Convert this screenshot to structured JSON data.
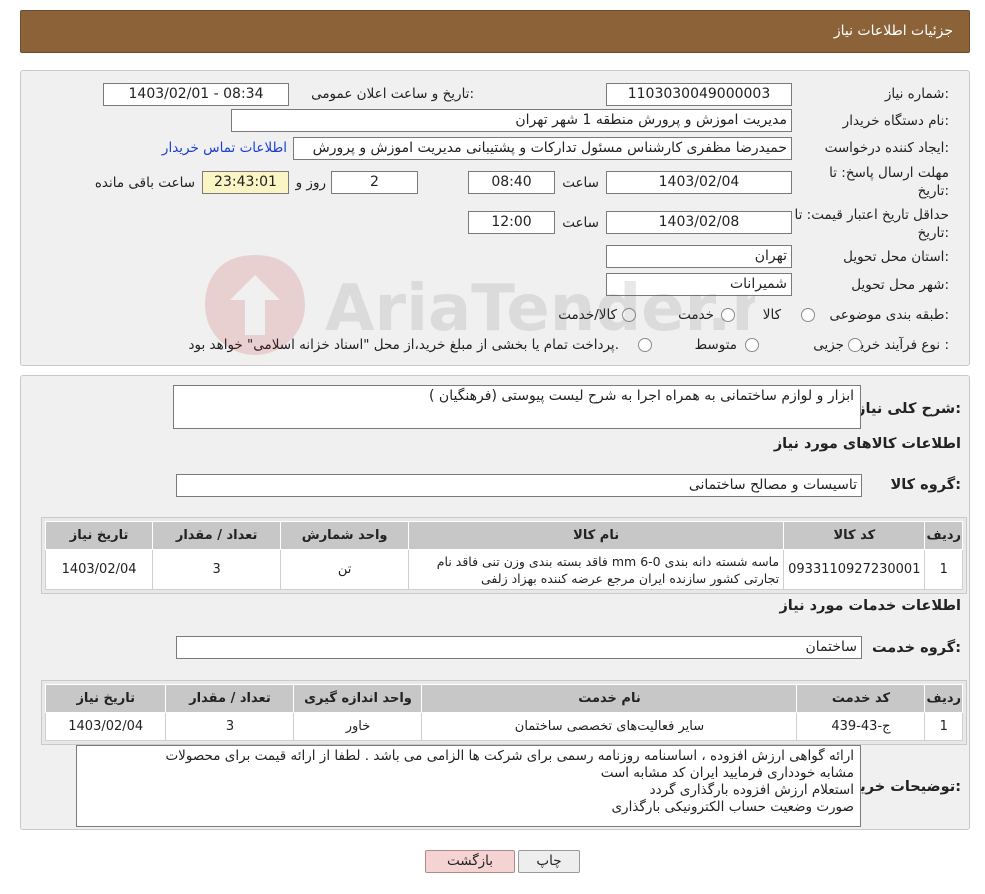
{
  "header": {
    "title": "جزئیات اطلاعات نیاز"
  },
  "form": {
    "need_number_label": "شماره نیاز:",
    "need_number": "1103030049000003",
    "announce_label": "تاریخ و ساعت اعلان عمومی:",
    "announce_value": "1403/02/01 - 08:34",
    "buyer_org_label": "نام دستگاه خریدار:",
    "buyer_org": "مدیریت اموزش و پرورش منطقه 1 شهر تهران",
    "creator_label": "ایجاد کننده درخواست:",
    "creator": "حمیدرضا مظفری کارشناس مسئول تدارکات و پشتیبانی مدیریت اموزش و پرورش",
    "contact_link": "اطلاعات تماس خریدار",
    "deadline_label_1": "مهلت ارسال پاسخ: تا",
    "deadline_label_2": "تاریخ:",
    "deadline_date": "1403/02/04",
    "time_label": "ساعت",
    "deadline_time": "08:40",
    "days_value": "2",
    "days_label": "روز و",
    "remaining_value": "23:43:01",
    "remaining_label": "ساعت باقی مانده",
    "validity_label_1": "حداقل تاریخ اعتبار قیمت: تا",
    "validity_label_2": "تاریخ:",
    "validity_date": "1403/02/08",
    "validity_time": "12:00",
    "province_label": "استان محل تحویل:",
    "province": "تهران",
    "city_label": "شهر محل تحویل:",
    "city": "شمیرانات",
    "category_label": "طبقه بندی موضوعی:",
    "category_options": [
      "کالا",
      "خدمت",
      "کالا/خدمت"
    ],
    "process_label": "نوع فرآیند خرید :",
    "process_options": [
      "جزیی",
      "متوسط"
    ],
    "process_note": "پرداخت تمام یا بخشی از مبلغ خرید،از محل \"اسناد خزانه اسلامی\" خواهد بود."
  },
  "summary": {
    "label": "شرح کلی نیاز:",
    "text": "ابزار و لوازم ساختمانی به همراه اجرا به شرح لیست پیوستی (فرهنگیان )"
  },
  "goods": {
    "section_title": "اطلاعات کالاهای مورد نیاز",
    "group_label": "گروه کالا:",
    "group_value": "تاسیسات و مصالح ساختمانی",
    "headers": [
      "ردیف",
      "کد کالا",
      "نام کالا",
      "واحد شمارش",
      "تعداد / مقدار",
      "تاریخ نیاز"
    ],
    "rows": [
      {
        "index": "1",
        "code": "0933110927230001",
        "name": "ماسه شسته دانه بندی mm 6-0 فاقد بسته بندی وزن تنی فاقد نام تجارتی کشور سازنده ایران مرجع عرضه کننده بهزاد زلفی",
        "unit": "تن",
        "qty": "3",
        "date": "1403/02/04"
      }
    ]
  },
  "services": {
    "section_title": "اطلاعات خدمات مورد نیاز",
    "group_label": "گروه خدمت:",
    "group_value": "ساختمان",
    "headers": [
      "ردیف",
      "کد خدمت",
      "نام خدمت",
      "واحد اندازه گیری",
      "تعداد / مقدار",
      "تاریخ نیاز"
    ],
    "rows": [
      {
        "index": "1",
        "code": "ج-43-439",
        "name": "سایر فعالیت‌های تخصصی ساختمان",
        "unit": "خاور",
        "qty": "3",
        "date": "1403/02/04"
      }
    ]
  },
  "buyer_notes": {
    "label": "توضیحات خریدار:",
    "lines": [
      "ارائه گواهی ارزش افزوده ، اساسنامه  روزنامه رسمی برای شرکت ها الزامی می باشد . لطفا از ارائه قیمت برای محصولات",
      "مشابه خودداری فرمایید ایران کد مشابه است",
      "استعلام ارزش افزوده بارگذاری گردد",
      "صورت وضعیت حساب الکترونیکی بارگذاری"
    ]
  },
  "buttons": {
    "print": "چاپ",
    "back": "بازگشت"
  },
  "watermark": {
    "text": "AriaTender.neT"
  }
}
